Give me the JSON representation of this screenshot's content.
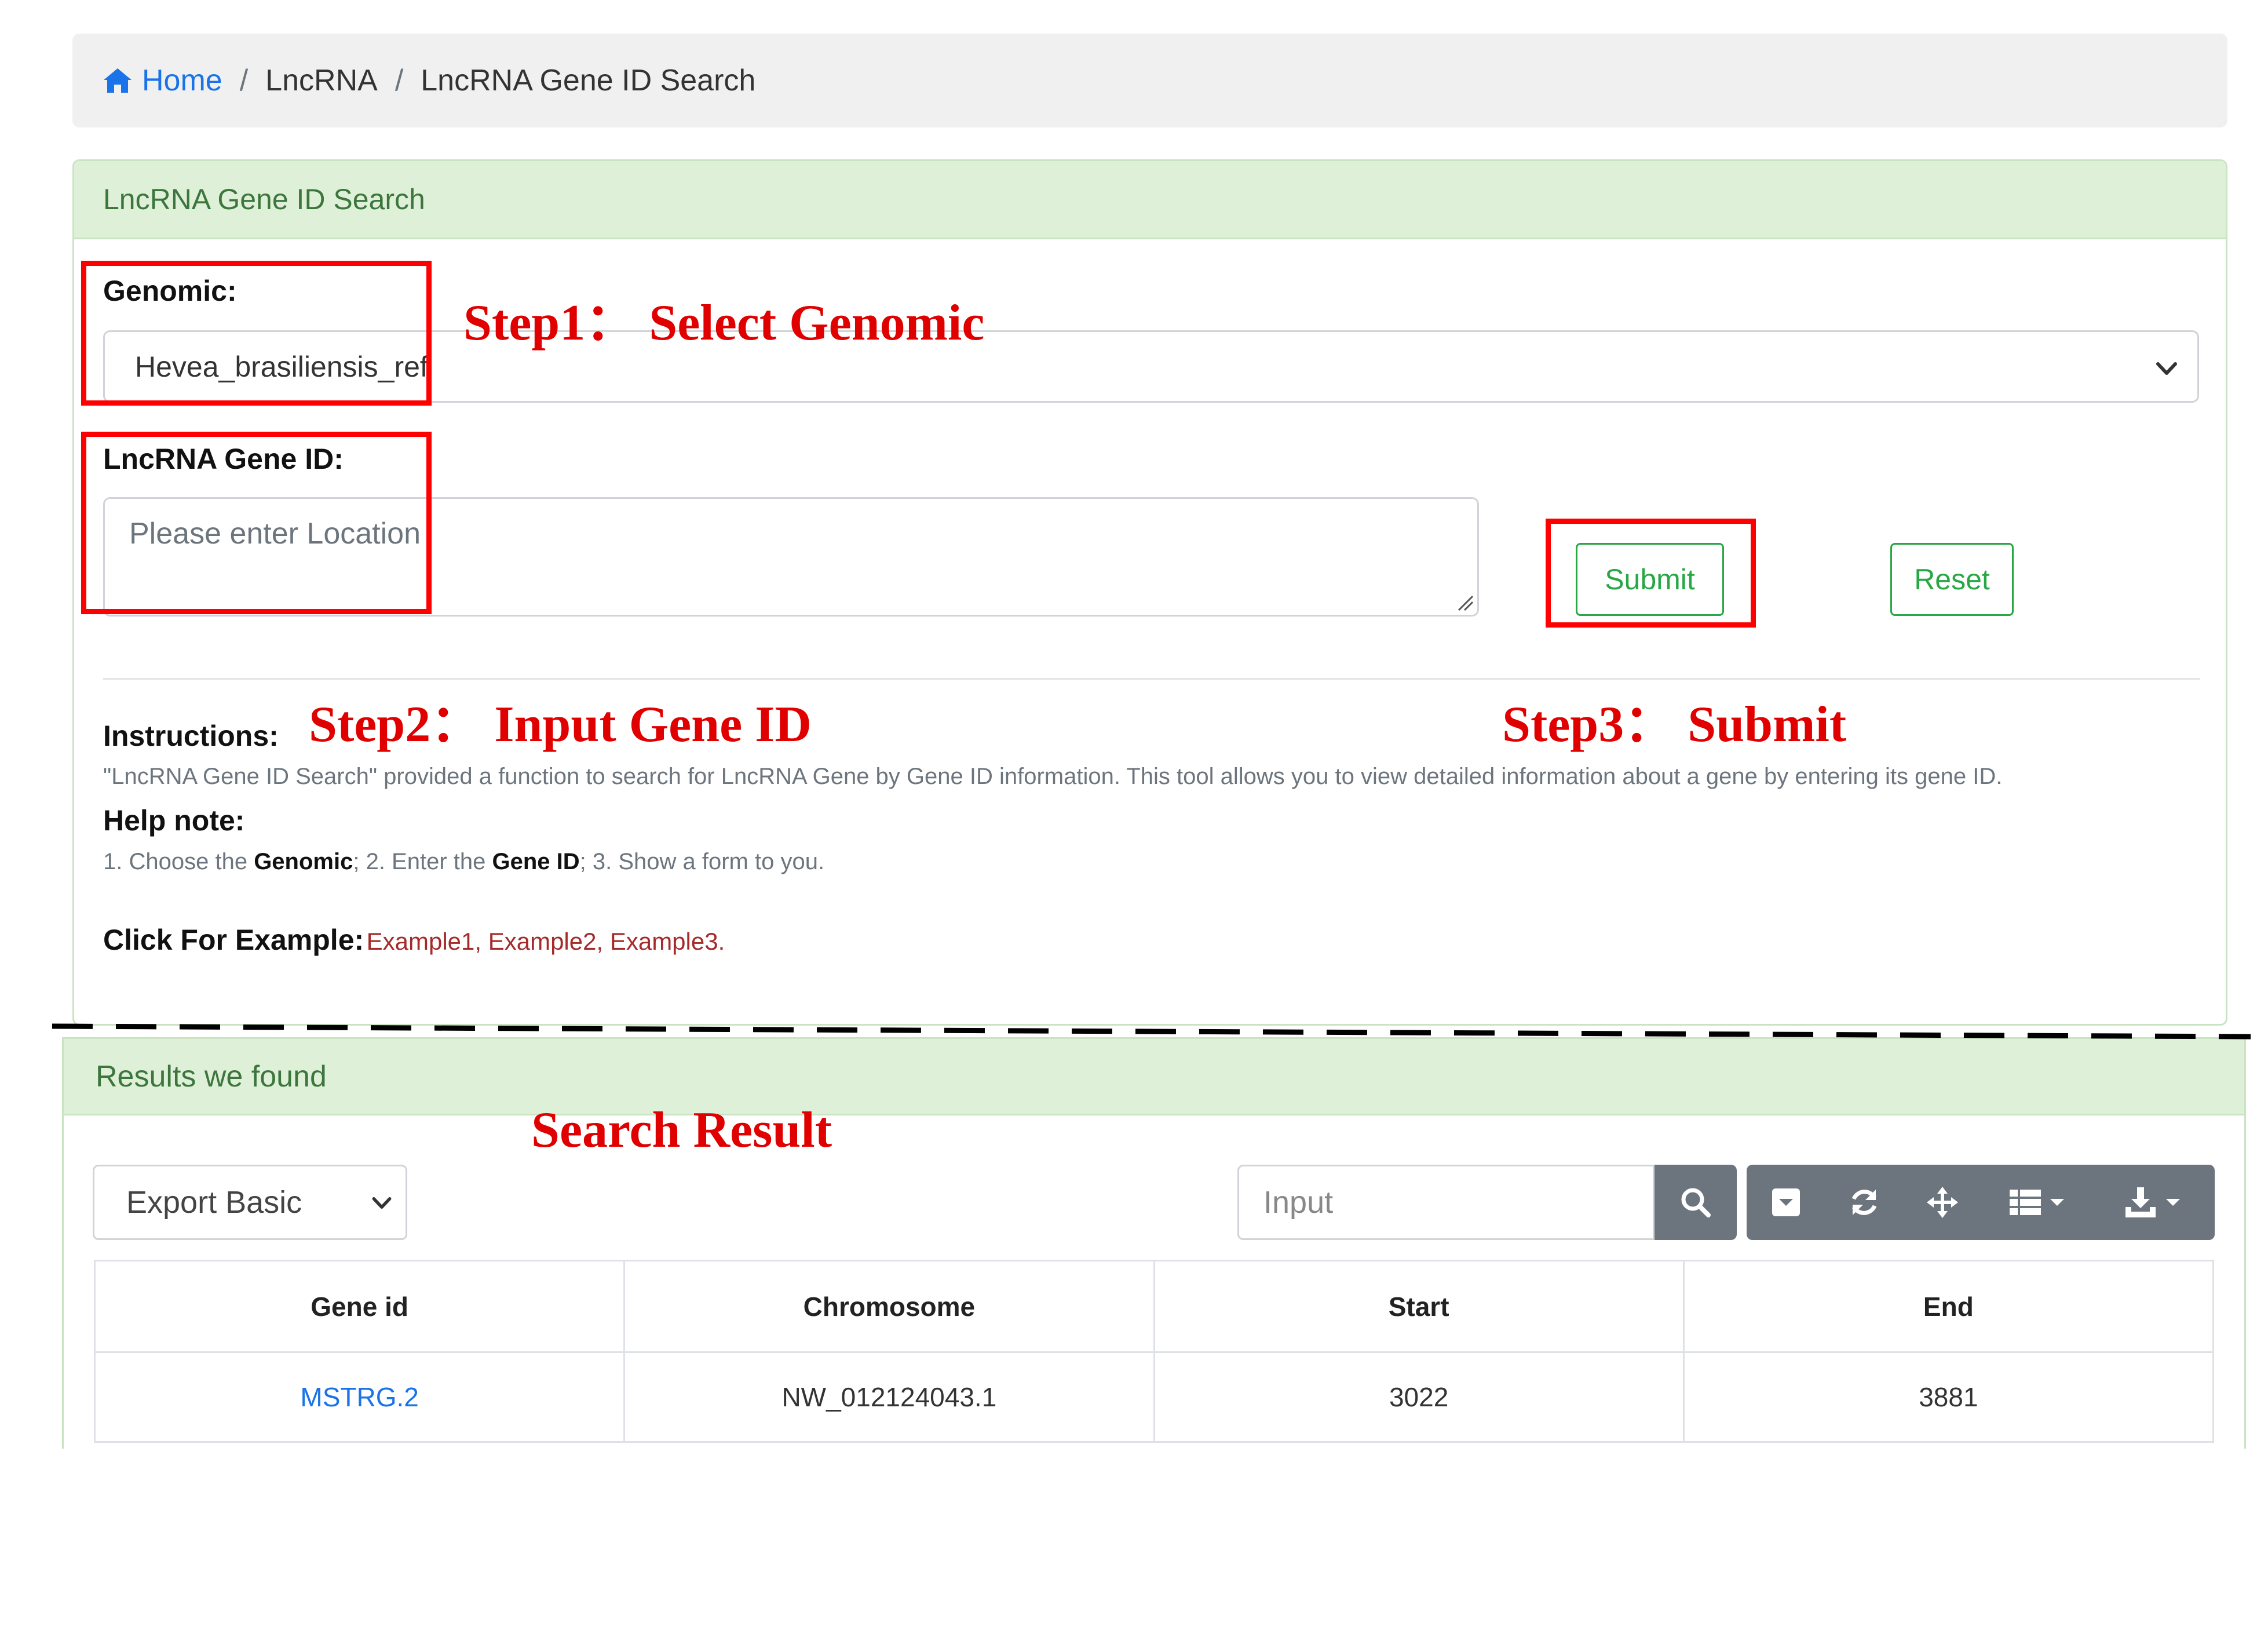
{
  "breadcrumb": {
    "home": "Home",
    "sep1": "/",
    "level1": "LncRNA",
    "sep2": "/",
    "current": "LncRNA Gene ID Search"
  },
  "search_panel": {
    "title": "LncRNA Gene ID Search",
    "genomic_label": "Genomic:",
    "genomic_value": "Hevea_brasiliensis_ref",
    "gene_id_label": "LncRNA Gene ID:",
    "gene_id_placeholder": "Please enter Location",
    "submit_label": "Submit",
    "reset_label": "Reset",
    "instructions_title": "Instructions:",
    "instructions_text": "\"LncRNA Gene ID Search\" provided a function to search for LncRNA Gene by Gene ID information. This tool allows you to view detailed information about a gene by entering its gene ID.",
    "help_title": "Help note:",
    "help_parts": [
      "1. Choose the ",
      "Genomic",
      "; 2. Enter the ",
      "Gene ID",
      "; 3. Show a form to you."
    ],
    "example_title": "Click For Example:",
    "examples": [
      "Example1",
      "Example2",
      "Example3"
    ],
    "example_seps": [
      ", ",
      ", ",
      "."
    ]
  },
  "annotations": {
    "step1": "Step1： Select Genomic",
    "step2": "Step2： Input Gene ID",
    "step3": "Step3： Submit",
    "search_result": "Search Result"
  },
  "results_panel": {
    "title": "Results we found",
    "export_value": "Export Basic",
    "search_placeholder": "Input",
    "toolbar_icons": [
      "search-icon",
      "toggle-pagination-icon",
      "refresh-icon",
      "fullscreen-move-icon",
      "columns-icon",
      "export-download-icon"
    ],
    "table": {
      "headers": [
        "Gene id",
        "Chromosome",
        "Start",
        "End"
      ],
      "rows": [
        [
          "MSTRG.2",
          "NW_012124043.1",
          "3022",
          "3881"
        ]
      ]
    }
  },
  "colors": {
    "annotation_red": "#ff0000",
    "panel_header_green": "#dff0d8",
    "button_green": "#28a745",
    "link_blue": "#1a73e8",
    "example_red": "#a52a2a",
    "toolbar_gray": "#6c757d"
  }
}
